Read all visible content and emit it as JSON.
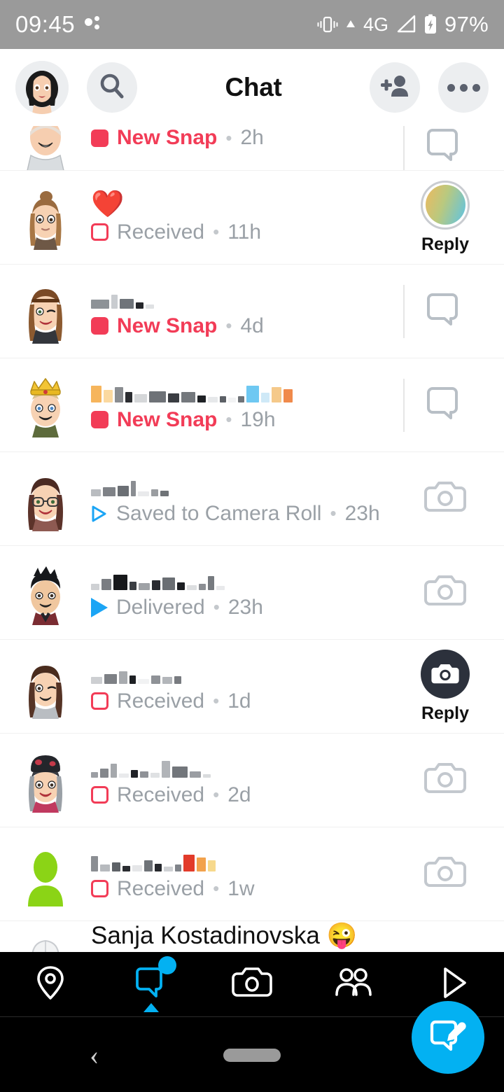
{
  "status_bar": {
    "time": "09:45",
    "network": "4G",
    "battery": "97%",
    "icons": [
      "assistant-dots-icon",
      "vibrate-icon",
      "uplink-icon",
      "signal-icon",
      "battery-charging-icon"
    ]
  },
  "header": {
    "title": "Chat",
    "avatar_label": "profile-avatar",
    "search_label": "Search",
    "add_friend_label": "Add Friends",
    "more_label": "More Options"
  },
  "chat_list": [
    {
      "name": "",
      "name_style": "blurred",
      "status": "New Snap",
      "status_type": "new-snap",
      "time": "2h",
      "action": "chat-bubble",
      "action_label": "",
      "partial": true
    },
    {
      "name": "❤️",
      "name_style": "emoji",
      "status": "Received",
      "status_type": "received",
      "time": "11h",
      "action": "story-ring",
      "action_label": "Reply",
      "partial": false
    },
    {
      "name": "",
      "name_style": "blurred",
      "status": "New Snap",
      "status_type": "new-snap",
      "time": "4d",
      "action": "chat-bubble",
      "action_label": "",
      "partial": false
    },
    {
      "name": "",
      "name_style": "blurred",
      "status": "New Snap",
      "status_type": "new-snap",
      "time": "19h",
      "action": "chat-bubble",
      "action_label": "",
      "partial": false
    },
    {
      "name": "",
      "name_style": "blurred",
      "status": "Saved to Camera Roll",
      "status_type": "saved",
      "time": "23h",
      "action": "camera",
      "action_label": "",
      "partial": false
    },
    {
      "name": "",
      "name_style": "blurred",
      "status": "Delivered",
      "status_type": "delivered",
      "time": "23h",
      "action": "camera",
      "action_label": "",
      "partial": false
    },
    {
      "name": "",
      "name_style": "blurred",
      "status": "Received",
      "status_type": "received",
      "time": "1d",
      "action": "camera-dark",
      "action_label": "Reply",
      "partial": false
    },
    {
      "name": "",
      "name_style": "blurred",
      "status": "Received",
      "status_type": "received",
      "time": "2d",
      "action": "camera",
      "action_label": "",
      "partial": false
    },
    {
      "name": "",
      "name_style": "blurred",
      "status": "Received",
      "status_type": "received",
      "time": "1w",
      "action": "camera",
      "action_label": "",
      "partial": false
    },
    {
      "name": "Sanja Kostadinovska 😜",
      "name_style": "plain",
      "status": "",
      "status_type": "",
      "time": "",
      "action": "none",
      "action_label": "",
      "partial": true
    }
  ],
  "fab": {
    "label": "New Chat",
    "icon": "new-chat-pencil-icon",
    "color": "#03b1f2"
  },
  "bottom_nav": [
    {
      "icon": "map-pin-icon",
      "label": "Map",
      "active": false,
      "badge": false
    },
    {
      "icon": "chat-bubble-icon",
      "label": "Chat",
      "active": true,
      "badge": true
    },
    {
      "icon": "camera-icon",
      "label": "Camera",
      "active": false,
      "badge": false
    },
    {
      "icon": "friends-icon",
      "label": "Stories",
      "active": false,
      "badge": false
    },
    {
      "icon": "play-triangle-icon",
      "label": "Spotlight",
      "active": false,
      "badge": false
    }
  ],
  "android_nav": {
    "back": "‹",
    "home_pill": "home-pill"
  },
  "colors": {
    "accent_blue": "#03b1f2",
    "snap_red": "#f23c57",
    "status_gray": "#9aa0a6",
    "header_bg": "#ffffff",
    "statusbar_bg": "#9a9a9a"
  }
}
